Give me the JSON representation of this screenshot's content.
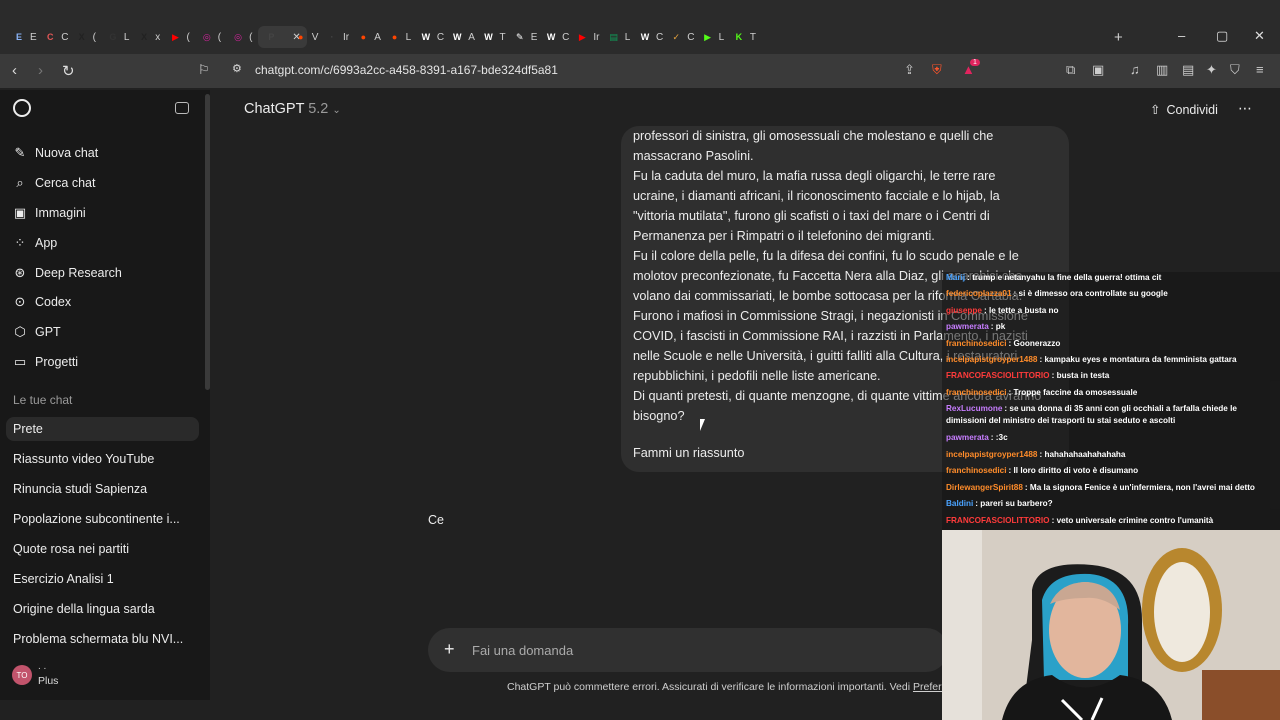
{
  "browser": {
    "tabs": [
      {
        "letter": "E",
        "label": "E",
        "color": "#8ab4f8"
      },
      {
        "letter": "C",
        "label": "C",
        "color": "#e05656"
      },
      {
        "letter": "X",
        "label": "(",
        "color": "#222222"
      },
      {
        "letter": "G",
        "label": "L",
        "color": "#333333"
      },
      {
        "letter": "X",
        "label": "x",
        "color": "#222222"
      },
      {
        "letter": "▶",
        "label": "(",
        "color": "#ff0000"
      },
      {
        "letter": "◎",
        "label": "(",
        "color": "#d6249f"
      },
      {
        "letter": "◎",
        "label": "(",
        "color": "#d6249f"
      },
      {
        "letter": "P",
        "label": "",
        "color": "#444444"
      },
      {
        "letter": "●",
        "label": "V",
        "color": "#ff4500"
      },
      {
        "letter": "·",
        "label": "Ir",
        "color": "#444444"
      },
      {
        "letter": "●",
        "label": "A",
        "color": "#ff4500"
      },
      {
        "letter": "●",
        "label": "L",
        "color": "#ff4500"
      },
      {
        "letter": "W",
        "label": "C",
        "color": "#ffffff"
      },
      {
        "letter": "W",
        "label": "A",
        "color": "#ffffff"
      },
      {
        "letter": "W",
        "label": "T",
        "color": "#ffffff"
      },
      {
        "letter": "✎",
        "label": "E",
        "color": "#ffffff"
      },
      {
        "letter": "W",
        "label": "C",
        "color": "#ffffff"
      },
      {
        "letter": "▶",
        "label": "Ir",
        "color": "#ff0000"
      },
      {
        "letter": "▤",
        "label": "L",
        "color": "#0f9d58"
      },
      {
        "letter": "W",
        "label": "C",
        "color": "#ffffff"
      },
      {
        "letter": "✓",
        "label": "C",
        "color": "#e8a33d"
      },
      {
        "letter": "▶",
        "label": "L",
        "color": "#53fc18"
      },
      {
        "letter": "K",
        "label": "T",
        "color": "#53fc18"
      }
    ],
    "new_tab": "+",
    "url": "chatgpt.com/c/6993a2cc-a458-8391-a167-bde324df5a81",
    "badge_count": "1"
  },
  "sidebar": {
    "nav": [
      {
        "icon": "✎",
        "label": "Nuova chat"
      },
      {
        "icon": "⌕",
        "label": "Cerca chat"
      },
      {
        "icon": "▣",
        "label": "Immagini"
      },
      {
        "icon": "⁘",
        "label": "App"
      },
      {
        "icon": "⊛",
        "label": "Deep Research"
      },
      {
        "icon": "⊙",
        "label": "Codex"
      },
      {
        "icon": "⬡",
        "label": "GPT"
      },
      {
        "icon": "▭",
        "label": "Progetti"
      }
    ],
    "section_title": "Le tue chat",
    "chats": [
      "Prete",
      "Riassunto video YouTube",
      "Rinuncia studi Sapienza",
      "Popolazione subcontinente i...",
      "Quote rosa nei partiti",
      "Esercizio Analisi 1",
      "Origine della lingua sarda",
      "Problema schermata blu NVI..."
    ],
    "user": {
      "initials": "TO",
      "name": ". .",
      "plan": "Plus"
    }
  },
  "header": {
    "model_name": "ChatGPT",
    "model_version": "5.2",
    "share_label": "Condividi",
    "more": "⋯"
  },
  "message": {
    "lines": [
      "professori di sinistra, gli omosessuali che molestano e quelli che",
      "massacrano Pasolini.",
      "Fu la caduta del muro, la mafia russa degli oligarchi, le terre rare",
      "ucraine, i diamanti africani, il riconoscimento facciale e lo hijab, la",
      "\"vittoria mutilata\", furono gli scafisti o i taxi del mare o i Centri di",
      "Permanenza per i Rimpatri o il telefonino dei migranti.",
      "Fu il colore della pelle, fu la difesa dei confini, fu lo scudo penale e le",
      "molotov preconfezionate, fu Faccetta Nera alla Diaz, gli anarchici che",
      "volano dai commissariati, le bombe sottocasa per la riforma Cartabia.",
      "Furono i mafiosi in Commissione Stragi, i negazionisti in Commissione",
      "COVID, i fascisti in Commissione RAI, i razzisti in Parlamento, i nazisti",
      "nelle Scuole e nelle Università, i guitti falliti alla Cultura, i restauratori",
      "repubblichini, i pedofili nelle liste americane.",
      "Di quanti pretesti, di quante menzogne, di quante vittime ancora avranno",
      "bisogno?"
    ],
    "tail": "Fammi un riassunto"
  },
  "assistant_partial": "Ce",
  "composer": {
    "placeholder": "Fai una domanda",
    "disclaimer": "ChatGPT può commettere errori. Assicurati di verificare le informazioni importanti. Vedi",
    "disclaimer_link": "Preferenze sui cookie."
  },
  "stream_chat": [
    {
      "user": "Marij",
      "color": "#4aa3ff",
      "text": ": trump e netanyahu la fine della guerra! ottima cit"
    },
    {
      "user": "federicoplazza01",
      "color": "#ff8c2a",
      "text": ": si è dimesso ora controllate su google"
    },
    {
      "user": "giuseppe",
      "color": "#ff3b3b",
      "text": ": le tette a busta no"
    },
    {
      "user": "pawmerata",
      "color": "#c77dff",
      "text": ": pk"
    },
    {
      "user": "franchinosedici",
      "color": "#ff8c2a",
      "text": ": Goonerazzo"
    },
    {
      "user": "incelpapistgroyper1488",
      "color": "#ff8c2a",
      "text": ": kampaku eyes e montatura da femminista gattara"
    },
    {
      "user": "FRANCOFASCIOLITTORIO",
      "color": "#ff3b3b",
      "text": ": busta in testa"
    },
    {
      "user": "franchinosedici",
      "color": "#ff8c2a",
      "text": ": Troppe faccine da omosessuale"
    },
    {
      "user": "RexLucumone",
      "color": "#c77dff",
      "text": ": se una donna di 35 anni con gli occhiali a farfalla chiede le dimissioni del ministro dei trasporti tu stai seduto e ascolti"
    },
    {
      "user": "pawmerata",
      "color": "#c77dff",
      "text": ": :3c"
    },
    {
      "user": "incelpapistgroyper1488",
      "color": "#ff8c2a",
      "text": ": hahahahaahahahaha"
    },
    {
      "user": "franchinosedici",
      "color": "#ff8c2a",
      "text": ": Il loro diritto di voto è disumano"
    },
    {
      "user": "DirlewangerSpirit88",
      "color": "#ff8c2a",
      "text": ": Ma la signora Fenice è un'infermiera, non l'avrei mai detto"
    },
    {
      "user": "Baldini",
      "color": "#4aa3ff",
      "text": ": pareri su barbero?"
    },
    {
      "user": "FRANCOFASCIOLITTORIO",
      "color": "#ff3b3b",
      "text": ": veto universale crimine contro l'umanità"
    }
  ]
}
